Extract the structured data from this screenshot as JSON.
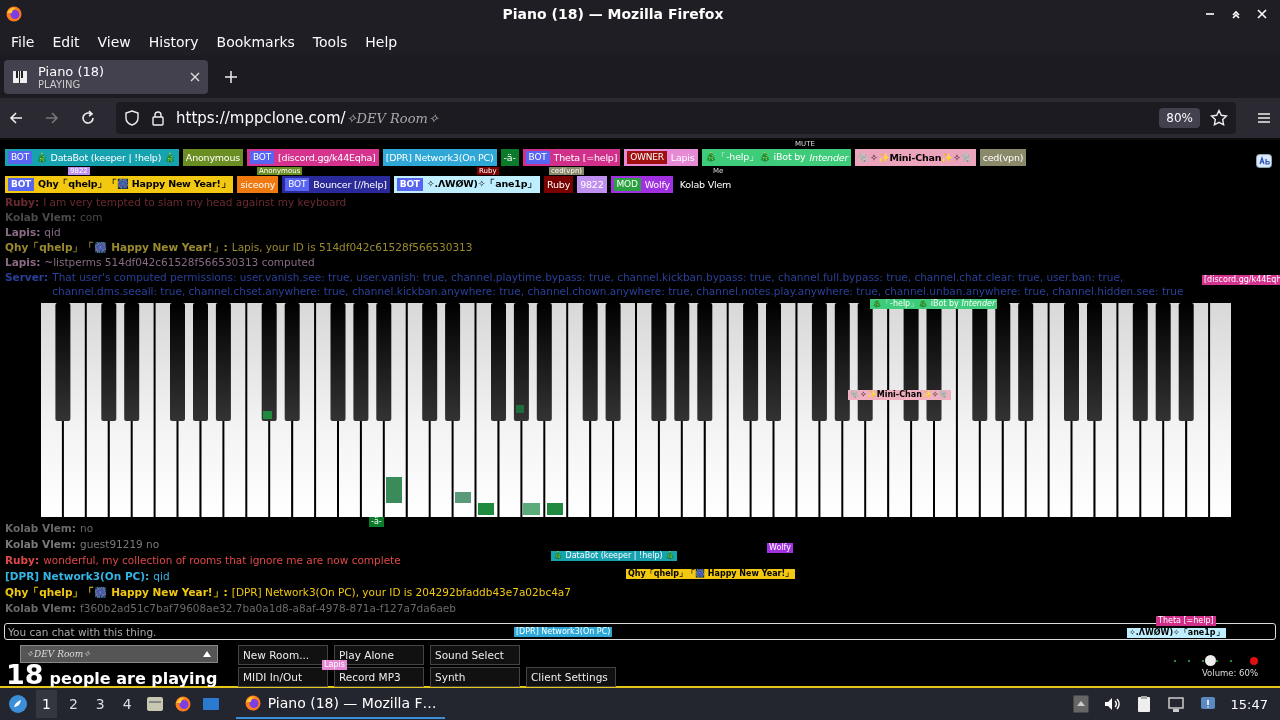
{
  "window": {
    "title": "Piano (18) — Mozilla Firefox"
  },
  "menu": [
    "File",
    "Edit",
    "View",
    "History",
    "Bookmarks",
    "Tools",
    "Help"
  ],
  "tabs": [
    {
      "label": "Piano (18)",
      "sublabel": "PLAYING",
      "selected": true
    }
  ],
  "address": {
    "host": "https://mppclone.com/",
    "path": "✧DEV Room✧",
    "zoom": "80%"
  },
  "participants": [
    {
      "badge": {
        "label": "BOT",
        "color": "#5865f2"
      },
      "name": "🎄 DataBot (keeper | !help) 🎄",
      "color": "#17a2b0"
    },
    {
      "name": "Anonymous",
      "color": "#6b8e23"
    },
    {
      "badge": {
        "label": "BOT",
        "color": "#5865f2"
      },
      "name": "[discord.gg/k44Eqha]",
      "color": "#d6338f"
    },
    {
      "name": "[DPR] Network3(On PC)",
      "color": "#2fa8d8"
    },
    {
      "name": "-ä-",
      "color": "#0b7a2b"
    },
    {
      "badge": {
        "label": "BOT",
        "color": "#5865f2"
      },
      "name": "Theta [=help]",
      "color": "#d0308a"
    },
    {
      "badge": {
        "label": "OWNER",
        "color": "#a01010"
      },
      "name": "Lapis",
      "color": "#e78ad6"
    },
    {
      "name": "🎄「-help」🎄 iBot by *Intender*",
      "color": "#3ecb7a"
    },
    {
      "name": "🐘✧✨Mini-Chan✨✧🐘",
      "color": "#eca4bc"
    },
    {
      "name": "ced(vpn)",
      "color": "#8a8a6a"
    },
    {
      "badge": {
        "label": "BOT",
        "color": "#5865f2"
      },
      "name": "Qhy「qhelp」「🎆 Happy New Year!」",
      "color": "#f2c811"
    },
    {
      "name": "siceony",
      "color": "#f07a10"
    },
    {
      "badge": {
        "label": "BOT",
        "color": "#5865f2"
      },
      "name": "Bouncer [//help]",
      "color": "#2a2a9a"
    },
    {
      "badge": {
        "label": "BOT",
        "color": "#5865f2"
      },
      "name": "✧.ΛWØW)✧「ane1p」",
      "color": "#bfefff"
    },
    {
      "name": "Ruby",
      "color": "#7a0000"
    },
    {
      "name": "9822",
      "color": "#c090f0"
    },
    {
      "badge": {
        "label": "MOD",
        "color": "#2aa040"
      },
      "name": "Wolfy",
      "color": "#a030e0"
    },
    {
      "name": "Kolab Vlem"
    }
  ],
  "chat": {
    "upper": [
      {
        "name": "Ruby:",
        "text": "I am very tempted to slam my head against my keyboard",
        "color": "#6a2a30"
      },
      {
        "name": "Kolab Vlem:",
        "text": "com",
        "color": "#4a4a4a"
      },
      {
        "name": "Lapis:",
        "text": "qid",
        "color": "#8a6a85"
      },
      {
        "name": "Qhy「qhelp」「🎆 Happy New Year!」:",
        "text": "Lapis, your ID is 514df042c61528f566530313",
        "color": "#9a8a30"
      },
      {
        "name": "Lapis:",
        "text": "~listperms 514df042c61528f566530313 computed",
        "color": "#8a6a85"
      },
      {
        "name": "Server:",
        "text": "That user's computed permissions: user.vanish.see: true, user.vanish: true, channel.playtime.bypass: true, channel.kickban.bypass: true, channel.full.bypass: true, channel.chat.clear: true, user.ban: true, channel.dms.seeall: true, channel.chset.anywhere: true, channel.kickban.anywhere: true, channel.chown.anywhere: true, channel.notes.play.anywhere: true, channel.unban.anywhere: true, channel.hidden.see: true",
        "color": "#2a4098"
      }
    ],
    "lower": [
      {
        "name": "Kolab Vlem:",
        "text": "no",
        "color": "#6a6a6a"
      },
      {
        "name": "Kolab Vlem:",
        "text": "guest91219 no",
        "color": "#7a7a7a"
      },
      {
        "name": "Ruby:",
        "text": "wonderful, my collection of rooms that ignore me are now complete",
        "color": "#e04848"
      },
      {
        "name": "[DPR] Network3(On PC):",
        "text": "qid",
        "color": "#33b5e5"
      },
      {
        "name": "Qhy「qhelp」「🎆 Happy New Year!」:",
        "text": "[DPR] Network3(On PC), your ID is 204292bfaddb43e7a02bc4a7",
        "color": "#f2c811"
      },
      {
        "name": "Kolab Vlem:",
        "text": "f360b2ad51c7baf79608ae32.7ba0a1d8-a8af-4978-871a-f127a7da6aeb",
        "color": "#6a6a6a"
      }
    ],
    "placeholder": "You can chat with this thing."
  },
  "cursors": [
    {
      "name": "MUTE"
    },
    {
      "name": "9822",
      "color": "#c090f0"
    },
    {
      "name": "Anonymous",
      "color": "#6b8e23"
    },
    {
      "name": "Ruby",
      "color": "#7a0000"
    },
    {
      "name": "ced(vpn)",
      "color": "#8a8a6a"
    },
    {
      "name": "Me"
    },
    {
      "name": "🎄「-help」🎄 iBot by *Intender*",
      "color": "#3ecb7a"
    },
    {
      "name": "[discord.gg/k44Eqh",
      "color": "#d6338f"
    },
    {
      "name": "🐘✧✨Mini-Chan✨✧🐘",
      "color": "#f0b0c0"
    },
    {
      "name": "-ä-",
      "color": "#0b7a2b"
    },
    {
      "name": "🎄 DataBot (keeper | !help) 🎄",
      "color": "#17a2b0"
    },
    {
      "name": "Wolfy",
      "color": "#a030e0"
    },
    {
      "name": "Qhy「qhelp」「🎆 Happy New Year!」",
      "color": "#f2c811"
    },
    {
      "name": "[DPR] Network3(On PC)",
      "color": "#2fa8d8"
    },
    {
      "name": "Theta [=help]",
      "color": "#d0308a"
    },
    {
      "name": "✧.ΛWØW)✧「ane1p」",
      "color": "#bfefff"
    },
    {
      "name": "Lapis",
      "color": "#e78ad6"
    }
  ],
  "room": {
    "name": "✧DEV Room✧"
  },
  "player_count": {
    "number": "18",
    "label": "people are playing"
  },
  "buttons": [
    [
      "New Room...",
      "Play Alone",
      "Sound Select"
    ],
    [
      "MIDI In/Out",
      "Record MP3",
      "Synth",
      "Client Settings"
    ]
  ],
  "volume": {
    "level": 0.6,
    "label": "Volume: 60%"
  },
  "taskbar": {
    "workspaces": [
      {
        "label": "1",
        "selected": true
      },
      {
        "label": "2",
        "selected": false
      },
      {
        "label": "3",
        "selected": false
      },
      {
        "label": "4",
        "selected": false
      }
    ],
    "task": "Piano (18) — Mozilla F…",
    "clock": "15:47"
  }
}
